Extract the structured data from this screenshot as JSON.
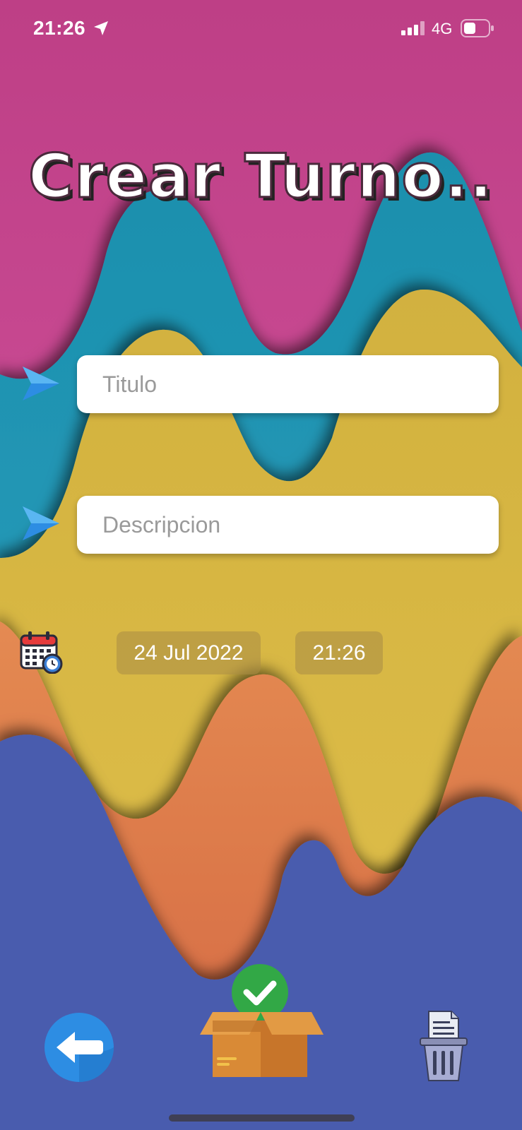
{
  "status_bar": {
    "time": "21:26",
    "network": "4G",
    "icons": [
      "location-arrow-icon",
      "signal-bars-icon",
      "battery-icon"
    ]
  },
  "page": {
    "title": "Crear Turno.."
  },
  "form": {
    "title_placeholder": "Titulo",
    "title_value": "",
    "description_placeholder": "Descripcion",
    "description_value": "",
    "date": "24 Jul 2022",
    "time": "21:26",
    "icons": [
      "arrow-icon",
      "calendar-clock-icon"
    ]
  },
  "actions": {
    "icons": [
      "back-arrow-icon",
      "save-box-check-icon",
      "trash-icon"
    ]
  },
  "colors": {
    "pink": "#c9478f",
    "teal": "#1f97b5",
    "yellow": "#d9b944",
    "orange": "#e0784a",
    "blue": "#4a5cae",
    "accent_blue": "#2d8de3",
    "check_green": "#32a846"
  }
}
